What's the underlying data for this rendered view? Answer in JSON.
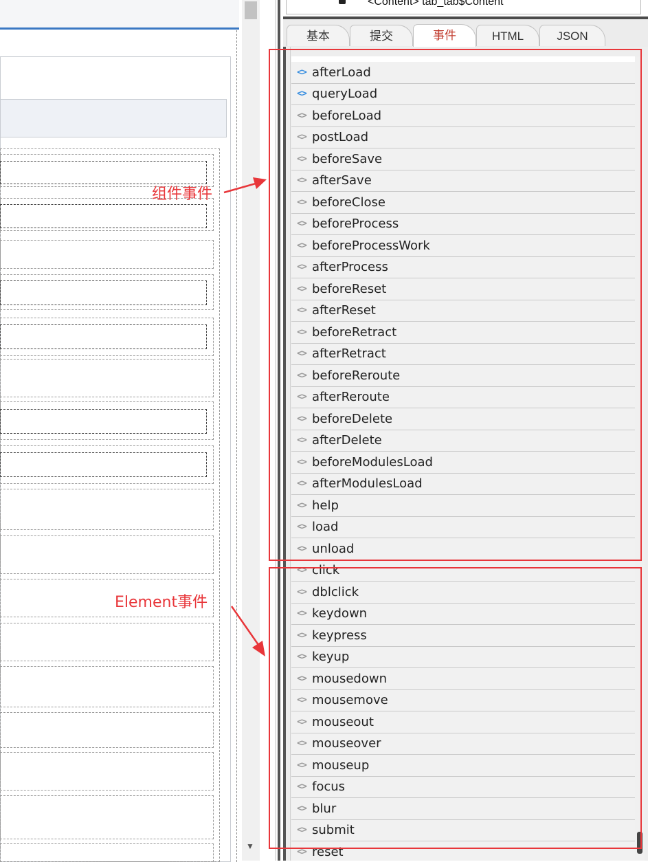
{
  "tree": {
    "node_text": "<Content> tab_tab$Content"
  },
  "tabs": [
    {
      "label": "基本",
      "active": false
    },
    {
      "label": "提交",
      "active": false
    },
    {
      "label": "事件",
      "active": true
    },
    {
      "label": "HTML",
      "active": false
    },
    {
      "label": "JSON",
      "active": false
    }
  ],
  "events": [
    {
      "name": "afterLoad",
      "icon": "code-brackets-icon",
      "has_handler": true
    },
    {
      "name": "queryLoad",
      "icon": "code-brackets-icon",
      "has_handler": true
    },
    {
      "name": "beforeLoad",
      "icon": "code-brackets-icon",
      "has_handler": false
    },
    {
      "name": "postLoad",
      "icon": "code-brackets-icon",
      "has_handler": false
    },
    {
      "name": "beforeSave",
      "icon": "code-brackets-icon",
      "has_handler": false
    },
    {
      "name": "afterSave",
      "icon": "code-brackets-icon",
      "has_handler": false
    },
    {
      "name": "beforeClose",
      "icon": "code-brackets-icon",
      "has_handler": false
    },
    {
      "name": "beforeProcess",
      "icon": "code-brackets-icon",
      "has_handler": false
    },
    {
      "name": "beforeProcessWork",
      "icon": "code-brackets-icon",
      "has_handler": false
    },
    {
      "name": "afterProcess",
      "icon": "code-brackets-icon",
      "has_handler": false
    },
    {
      "name": "beforeReset",
      "icon": "code-brackets-icon",
      "has_handler": false
    },
    {
      "name": "afterReset",
      "icon": "code-brackets-icon",
      "has_handler": false
    },
    {
      "name": "beforeRetract",
      "icon": "code-brackets-icon",
      "has_handler": false
    },
    {
      "name": "afterRetract",
      "icon": "code-brackets-icon",
      "has_handler": false
    },
    {
      "name": "beforeReroute",
      "icon": "code-brackets-icon",
      "has_handler": false
    },
    {
      "name": "afterReroute",
      "icon": "code-brackets-icon",
      "has_handler": false
    },
    {
      "name": "beforeDelete",
      "icon": "code-brackets-icon",
      "has_handler": false
    },
    {
      "name": "afterDelete",
      "icon": "code-brackets-icon",
      "has_handler": false
    },
    {
      "name": "beforeModulesLoad",
      "icon": "code-brackets-icon",
      "has_handler": false
    },
    {
      "name": "afterModulesLoad",
      "icon": "code-brackets-icon",
      "has_handler": false
    },
    {
      "name": "help",
      "icon": "code-brackets-icon",
      "has_handler": false
    },
    {
      "name": "load",
      "icon": "code-brackets-icon",
      "has_handler": false
    },
    {
      "name": "unload",
      "icon": "code-brackets-icon",
      "has_handler": false
    },
    {
      "name": "click",
      "icon": "code-brackets-icon",
      "has_handler": false
    },
    {
      "name": "dblclick",
      "icon": "code-brackets-icon",
      "has_handler": false
    },
    {
      "name": "keydown",
      "icon": "code-brackets-icon",
      "has_handler": false
    },
    {
      "name": "keypress",
      "icon": "code-brackets-icon",
      "has_handler": false
    },
    {
      "name": "keyup",
      "icon": "code-brackets-icon",
      "has_handler": false
    },
    {
      "name": "mousedown",
      "icon": "code-brackets-icon",
      "has_handler": false
    },
    {
      "name": "mousemove",
      "icon": "code-brackets-icon",
      "has_handler": false
    },
    {
      "name": "mouseout",
      "icon": "code-brackets-icon",
      "has_handler": false
    },
    {
      "name": "mouseover",
      "icon": "code-brackets-icon",
      "has_handler": false
    },
    {
      "name": "mouseup",
      "icon": "code-brackets-icon",
      "has_handler": false
    },
    {
      "name": "focus",
      "icon": "code-brackets-icon",
      "has_handler": false
    },
    {
      "name": "blur",
      "icon": "code-brackets-icon",
      "has_handler": false
    },
    {
      "name": "submit",
      "icon": "code-brackets-icon",
      "has_handler": false
    },
    {
      "name": "reset",
      "icon": "code-brackets-icon",
      "has_handler": false
    }
  ],
  "annotations": {
    "component_events": "组件事件",
    "element_events": "Element事件"
  },
  "colors": {
    "annotation_red": "#e8363a",
    "active_tab_text": "#c0392b",
    "handler_icon_blue": "#3a8fe0",
    "inactive_icon_gray": "#9a9a9a"
  }
}
